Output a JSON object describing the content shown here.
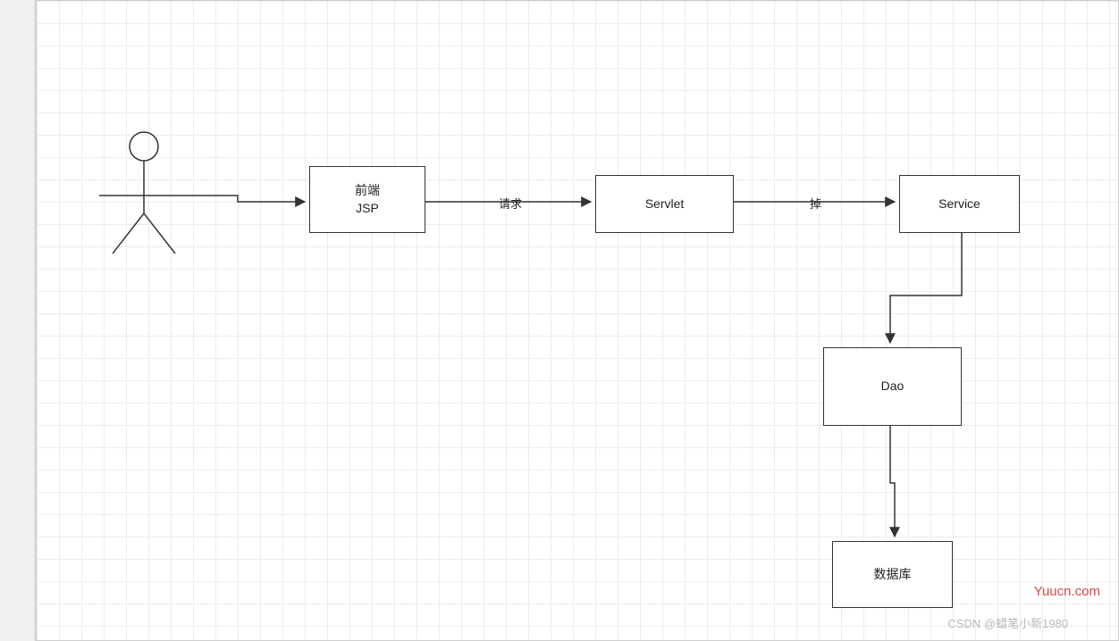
{
  "nodes": {
    "jsp": {
      "label": "前端\nJSP"
    },
    "servlet": {
      "label": "Servlet"
    },
    "service": {
      "label": "Service"
    },
    "dao": {
      "label": "Dao"
    },
    "db": {
      "label": "数据库"
    }
  },
  "edges": {
    "e1": {
      "label": "请求"
    },
    "e2": {
      "label": "掉"
    }
  },
  "watermarks": {
    "red": "Yuucn.com",
    "grey": "CSDN @蜡笔小新1980"
  },
  "colors": {
    "stroke": "#333333",
    "grid": "#ececec",
    "red": "#d64545",
    "grey": "#b8b8b8"
  }
}
